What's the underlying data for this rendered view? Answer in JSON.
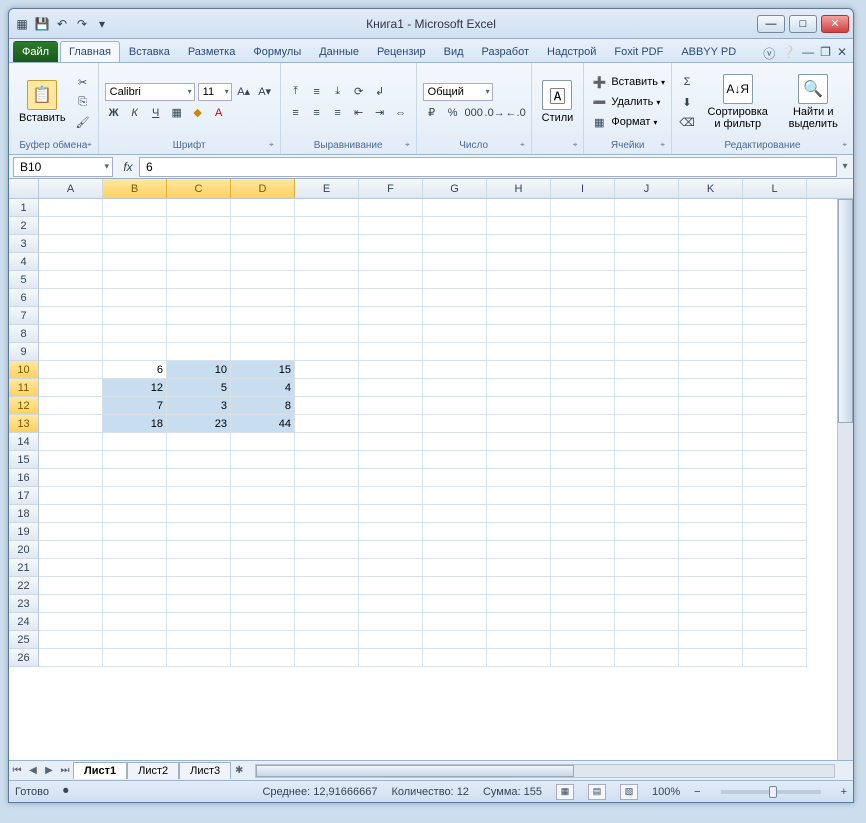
{
  "title": "Книга1  -  Microsoft Excel",
  "qat_tips": [
    "excel",
    "save",
    "undo",
    "redo",
    "customize"
  ],
  "tabs": {
    "file": "Файл",
    "items": [
      "Главная",
      "Вставка",
      "Разметка",
      "Формулы",
      "Данные",
      "Рецензир",
      "Вид",
      "Разработ",
      "Надстрой",
      "Foxit PDF",
      "ABBYY PD"
    ],
    "active": 0
  },
  "ribbon": {
    "clipboard": {
      "paste": "Вставить",
      "label": "Буфер обмена"
    },
    "font": {
      "name": "Calibri",
      "size": "11",
      "label": "Шрифт",
      "bold": "Ж",
      "italic": "К",
      "underline": "Ч"
    },
    "align": {
      "label": "Выравнивание"
    },
    "number": {
      "format": "Общий",
      "label": "Число"
    },
    "styles": {
      "btn": "Стили"
    },
    "cells": {
      "insert": "Вставить",
      "delete": "Удалить",
      "format": "Формат",
      "label": "Ячейки"
    },
    "editing": {
      "sort": "Сортировка и фильтр",
      "find": "Найти и выделить",
      "label": "Редактирование"
    }
  },
  "namebox": "B10",
  "fx_label": "fx",
  "formula": "6",
  "columns": [
    "A",
    "B",
    "C",
    "D",
    "E",
    "F",
    "G",
    "H",
    "I",
    "J",
    "K",
    "L"
  ],
  "sel_cols": [
    "B",
    "C",
    "D"
  ],
  "sel_rows": [
    10,
    11,
    12,
    13
  ],
  "active_cell": "B10",
  "grid": {
    "10": {
      "B": "6",
      "C": "10",
      "D": "15"
    },
    "11": {
      "B": "12",
      "C": "5",
      "D": "4"
    },
    "12": {
      "B": "7",
      "C": "3",
      "D": "8"
    },
    "13": {
      "B": "18",
      "C": "23",
      "D": "44"
    }
  },
  "row_count": 26,
  "sheets": {
    "items": [
      "Лист1",
      "Лист2",
      "Лист3"
    ],
    "active": 0
  },
  "status": {
    "ready": "Готово",
    "avg_label": "Среднее:",
    "avg": "12,91666667",
    "count_label": "Количество:",
    "count": "12",
    "sum_label": "Сумма:",
    "sum": "155",
    "zoom": "100%"
  }
}
